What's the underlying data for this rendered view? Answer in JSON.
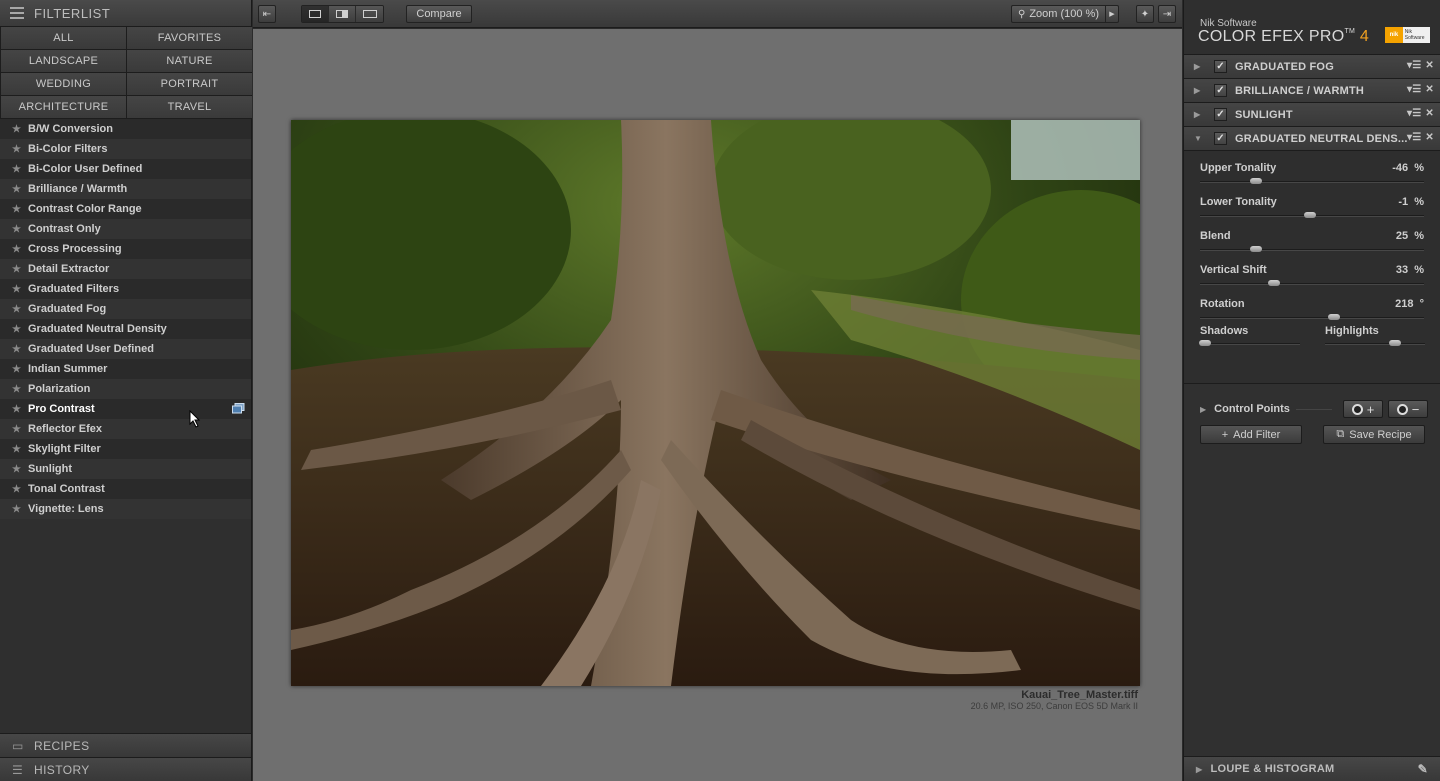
{
  "filterlist": {
    "title": "FILTERLIST",
    "categories": [
      "ALL",
      "FAVORITES",
      "LANDSCAPE",
      "NATURE",
      "WEDDING",
      "PORTRAIT",
      "ARCHITECTURE",
      "TRAVEL"
    ],
    "filters": [
      "B/W Conversion",
      "Bi-Color Filters",
      "Bi-Color User Defined",
      "Brilliance / Warmth",
      "Contrast Color Range",
      "Contrast Only",
      "Cross Processing",
      "Detail Extractor",
      "Graduated Filters",
      "Graduated Fog",
      "Graduated Neutral Density",
      "Graduated User Defined",
      "Indian Summer",
      "Polarization",
      "Pro Contrast",
      "Reflector Efex",
      "Skylight Filter",
      "Sunlight",
      "Tonal Contrast",
      "Vignette: Lens"
    ],
    "active_filter": "Pro Contrast"
  },
  "bottom_tabs": {
    "recipes": "RECIPES",
    "history": "HISTORY"
  },
  "toolbar": {
    "compare_label": "Compare",
    "zoom_label": "Zoom (100 %)"
  },
  "image": {
    "filename": "Kauai_Tree_Master.tiff",
    "meta": "20.6 MP, ISO 250, Canon EOS 5D Mark II"
  },
  "brand": {
    "vendor": "Nik Software",
    "product": "COLOR EFEX PRO",
    "tm": "TM",
    "version": "4",
    "logo_text": "Nik Software"
  },
  "stack": [
    {
      "name": "GRADUATED FOG",
      "checked": true,
      "expanded": false
    },
    {
      "name": "BRILLIANCE / WARMTH",
      "checked": true,
      "expanded": false
    },
    {
      "name": "SUNLIGHT",
      "checked": true,
      "expanded": false
    },
    {
      "name": "GRADUATED NEUTRAL DENS...",
      "checked": true,
      "expanded": true
    }
  ],
  "controls": {
    "upper_tonality": {
      "label": "Upper Tonality",
      "value": "-46",
      "unit": "%",
      "position": 0.25
    },
    "lower_tonality": {
      "label": "Lower Tonality",
      "value": "-1",
      "unit": "%",
      "position": 0.49
    },
    "blend": {
      "label": "Blend",
      "value": "25",
      "unit": "%",
      "position": 0.25
    },
    "vertical_shift": {
      "label": "Vertical Shift",
      "value": "33",
      "unit": "%",
      "position": 0.33
    },
    "rotation": {
      "label": "Rotation",
      "value": "218",
      "unit": "°",
      "position": 0.6
    },
    "shadows": {
      "label": "Shadows",
      "position": 0.05
    },
    "highlights": {
      "label": "Highlights",
      "position": 0.7
    }
  },
  "control_points_label": "Control Points",
  "actions": {
    "add_filter": "Add Filter",
    "save_recipe": "Save Recipe"
  },
  "loupe_label": "LOUPE & HISTOGRAM"
}
